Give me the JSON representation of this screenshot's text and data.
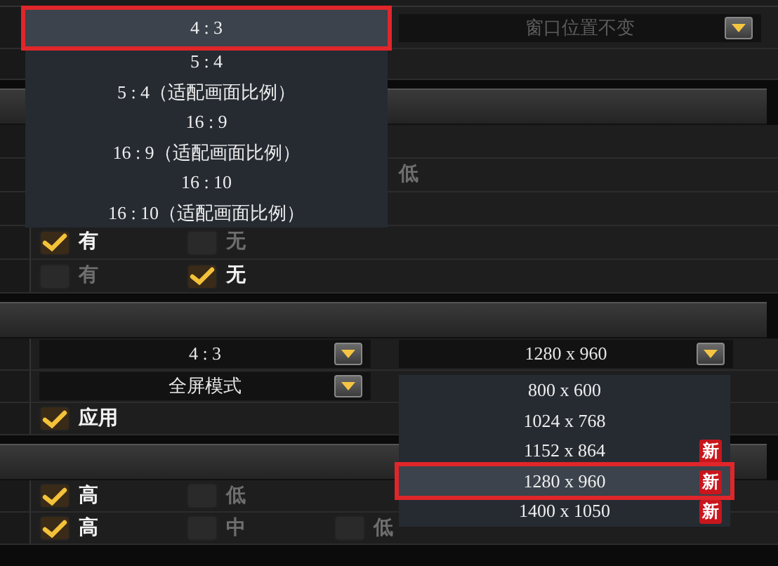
{
  "display_top": {
    "window_mode": {
      "value": "窗口位置不变",
      "disabled": true
    }
  },
  "aspect_list": [
    {
      "label": "4 : 3",
      "selected": true
    },
    {
      "label": "5 : 4",
      "selected": false
    },
    {
      "label": "5 : 4（适配画面比例）",
      "selected": false
    },
    {
      "label": "16 : 9",
      "selected": false
    },
    {
      "label": "16 : 9（适配画面比例）",
      "selected": false
    },
    {
      "label": "16 : 10",
      "selected": false
    },
    {
      "label": "16 : 10（适配画面比例）",
      "selected": false
    }
  ],
  "section_1": {
    "rows": [
      {
        "kind": "empty"
      },
      {
        "kind": "trailing",
        "label": "低"
      },
      {
        "kind": "empty"
      },
      {
        "kind": "choices",
        "options": [
          {
            "label": "有",
            "checked": true
          },
          {
            "label": "无",
            "checked": false
          }
        ]
      },
      {
        "kind": "choices",
        "options": [
          {
            "label": "有",
            "checked": false
          },
          {
            "label": "无",
            "checked": true
          }
        ]
      }
    ]
  },
  "section_2": {
    "rows": [
      {
        "kind": "dropdowns",
        "dropdowns": [
          {
            "value": "4 : 3"
          },
          {
            "value": "1280 x 960"
          }
        ]
      },
      {
        "kind": "dropdowns",
        "dropdowns": [
          {
            "value": "全屏模式"
          }
        ]
      },
      {
        "kind": "choices",
        "options": [
          {
            "label": "应用",
            "checked": true
          }
        ]
      }
    ]
  },
  "section_3": {
    "rows": [
      {
        "kind": "choices",
        "options": [
          {
            "label": "高",
            "checked": true
          },
          {
            "label": "低",
            "checked": false
          }
        ]
      },
      {
        "kind": "choices",
        "options": [
          {
            "label": "高",
            "checked": true
          },
          {
            "label": "中",
            "checked": false
          },
          {
            "label": "低",
            "checked": false
          }
        ]
      }
    ]
  },
  "resolution_list": [
    {
      "label": "800 x 600",
      "selected": false
    },
    {
      "label": "1024 x 768",
      "selected": false
    },
    {
      "label": "1152 x 864",
      "selected": false,
      "badge": "新"
    },
    {
      "label": "1280 x 960",
      "selected": true,
      "badge": "新"
    },
    {
      "label": "1400 x 1050",
      "selected": false,
      "badge": "新"
    }
  ]
}
